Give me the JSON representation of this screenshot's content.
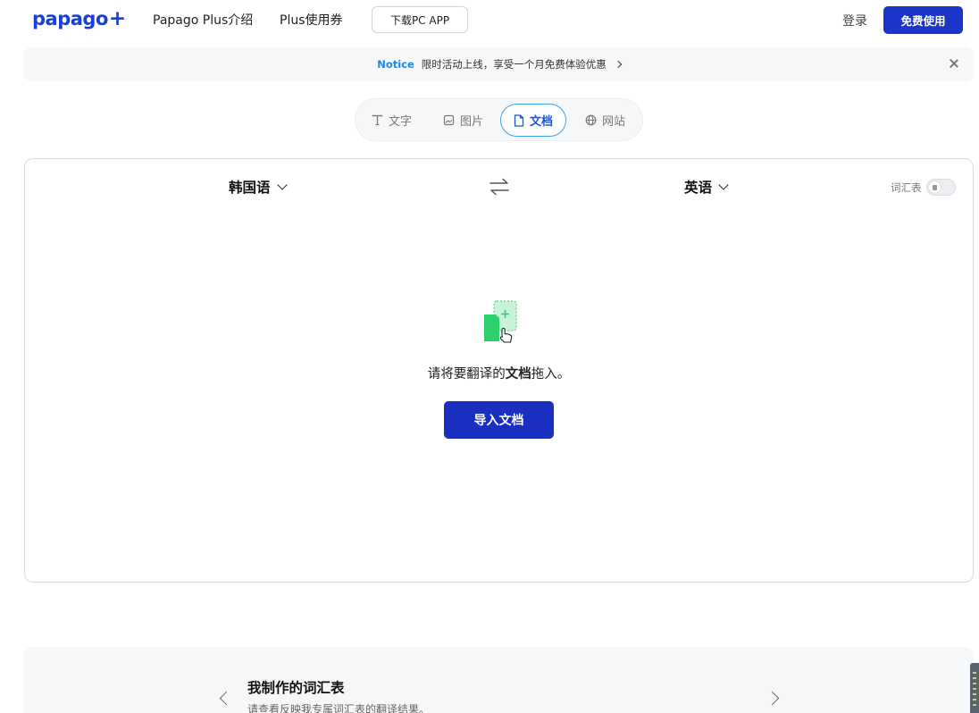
{
  "header": {
    "logo_text": "papago",
    "logo_plus": "+",
    "nav": [
      "Papago Plus介绍",
      "Plus使用券"
    ],
    "download_label": "下载PC APP",
    "login_label": "登录",
    "free_label": "免费使用"
  },
  "notice": {
    "label": "Notice",
    "text": "限时活动上线，享受一个月免费体验优惠"
  },
  "tabs": [
    {
      "label": "文字",
      "icon": "text-icon"
    },
    {
      "label": "图片",
      "icon": "image-icon"
    },
    {
      "label": "文档",
      "icon": "document-icon",
      "active": true
    },
    {
      "label": "网站",
      "icon": "globe-icon"
    }
  ],
  "translator": {
    "source_lang": "韩国语",
    "target_lang": "英语",
    "vocab_label": "词汇表",
    "vocab_enabled": false,
    "drop_prefix": "请将要翻译的",
    "drop_bold": "文档",
    "drop_suffix": "拖入。",
    "import_label": "导入文档"
  },
  "vocab_card": {
    "title": "我制作的词汇表",
    "subtitle": "请查看反映我专属词汇表的翻译结果。"
  },
  "colors": {
    "brand": "#1a3fd1",
    "primary_button": "#1a35c8",
    "notice_label": "#2088e8",
    "active_tab_border": "#3fa0e8",
    "doc_green": "#2ecf6b"
  }
}
